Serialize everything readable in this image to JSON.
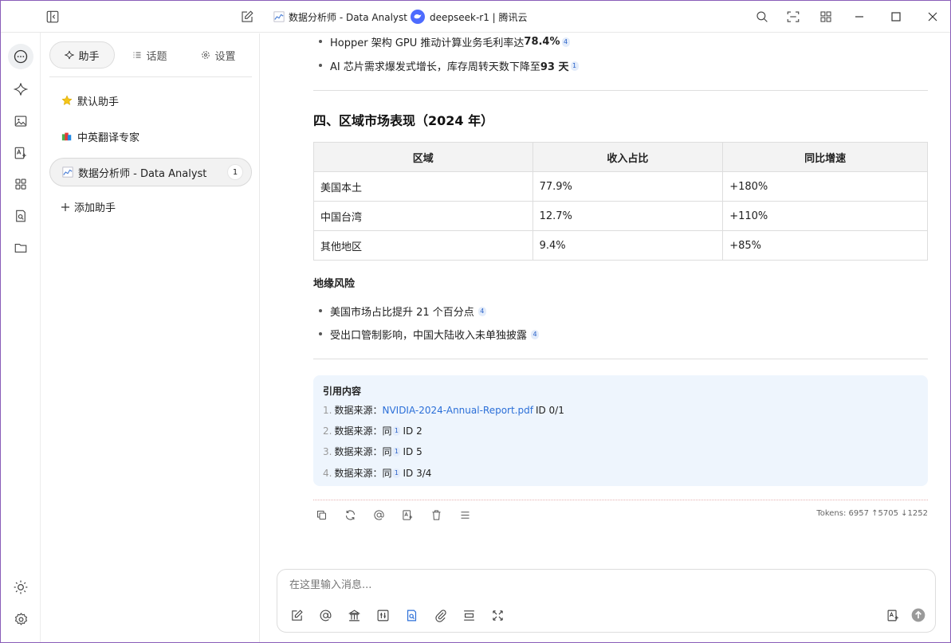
{
  "titlebar": {
    "tab_title": "数据分析师 - Data Analyst",
    "model_label": "deepseek-r1 | 腾讯云"
  },
  "sidebar_tabs": {
    "assistants": "助手",
    "topics": "话题",
    "settings": "设置"
  },
  "assistants": [
    {
      "label": "默认助手",
      "icon": "star-icon"
    },
    {
      "label": "中英翻译专家",
      "icon": "books-icon"
    },
    {
      "label": "数据分析师 - Data Analyst",
      "icon": "chart-icon",
      "count": "1"
    }
  ],
  "add_assistant": "添加助手",
  "message": {
    "bullets_top": [
      {
        "text_before": "Hopper 架构 GPU 推动计算业务毛利率达 ",
        "bold": "78.4%",
        "ref": "4"
      },
      {
        "text_before": "AI 芯片需求爆发式增长，库存周转天数下降至 ",
        "bold": "93 天",
        "ref": "1"
      }
    ],
    "section_title": "四、区域市场表现（2024 年）",
    "table": {
      "headers": [
        "区域",
        "收入占比",
        "同比增速"
      ],
      "rows": [
        [
          "美国本土",
          "77.9%",
          "+180%"
        ],
        [
          "中国台湾",
          "12.7%",
          "+110%"
        ],
        [
          "其他地区",
          "9.4%",
          "+85%"
        ]
      ]
    },
    "subheading": "地缘风险",
    "bullets_risk": [
      {
        "text": "美国市场占比提升 21 个百分点",
        "ref": "4"
      },
      {
        "text": "受出口管制影响，中国大陆收入未单独披露",
        "ref": "4"
      }
    ],
    "citations": {
      "title": "引用内容",
      "items": [
        {
          "num": "1.",
          "prefix": "数据来源：",
          "link": "NVIDIA-2024-Annual-Report.pdf",
          "suffix": "ID 0/1"
        },
        {
          "num": "2.",
          "prefix": "数据来源：同",
          "ref": "1",
          "suffix": "ID 2"
        },
        {
          "num": "3.",
          "prefix": "数据来源：同",
          "ref": "1",
          "suffix": "ID 5"
        },
        {
          "num": "4.",
          "prefix": "数据来源：同",
          "ref": "1",
          "suffix": "ID 3/4"
        }
      ]
    },
    "tokens": "Tokens: 6957 ↑5705 ↓1252"
  },
  "input": {
    "placeholder": "在这里输入消息..."
  },
  "colors": {
    "accent": "#17a35b",
    "link": "#2b6fd8",
    "citation_bg": "#eef5fd",
    "window_border": "#8a5db8"
  }
}
